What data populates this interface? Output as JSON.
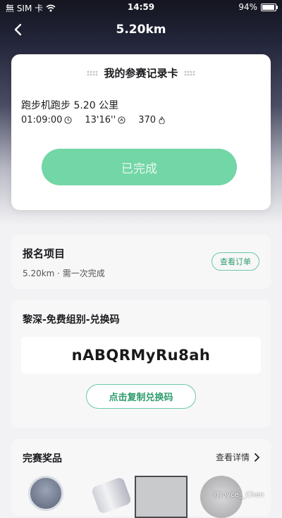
{
  "status_bar": {
    "carrier": "無 SIM 卡",
    "time": "14:59",
    "battery_text": "94%",
    "battery_level": 0.94
  },
  "nav": {
    "title": "5.20km"
  },
  "record_card": {
    "title": "我的参赛记录卡",
    "activity": "跑步机跑步 5.20 公里",
    "stats": {
      "duration": "01:09:00",
      "pace": "13'16''",
      "calories": "370"
    },
    "status_button": "已完成"
  },
  "signup": {
    "title": "报名项目",
    "subtitle": "5.20km · 需一次完成",
    "order_button": "查看订单"
  },
  "redeem": {
    "title": "黎深-免费组别-兑换码",
    "code": "nABQRMyRu8ah",
    "copy_button": "点击复制兑换码"
  },
  "prizes": {
    "title": "完赛奖品",
    "more_link": "查看详情"
  },
  "watermark": "@Joyce__Chen",
  "colors": {
    "accent_green": "#72d6a6",
    "outline_green": "#6cc9a1",
    "text_green": "#2e9c6c"
  }
}
